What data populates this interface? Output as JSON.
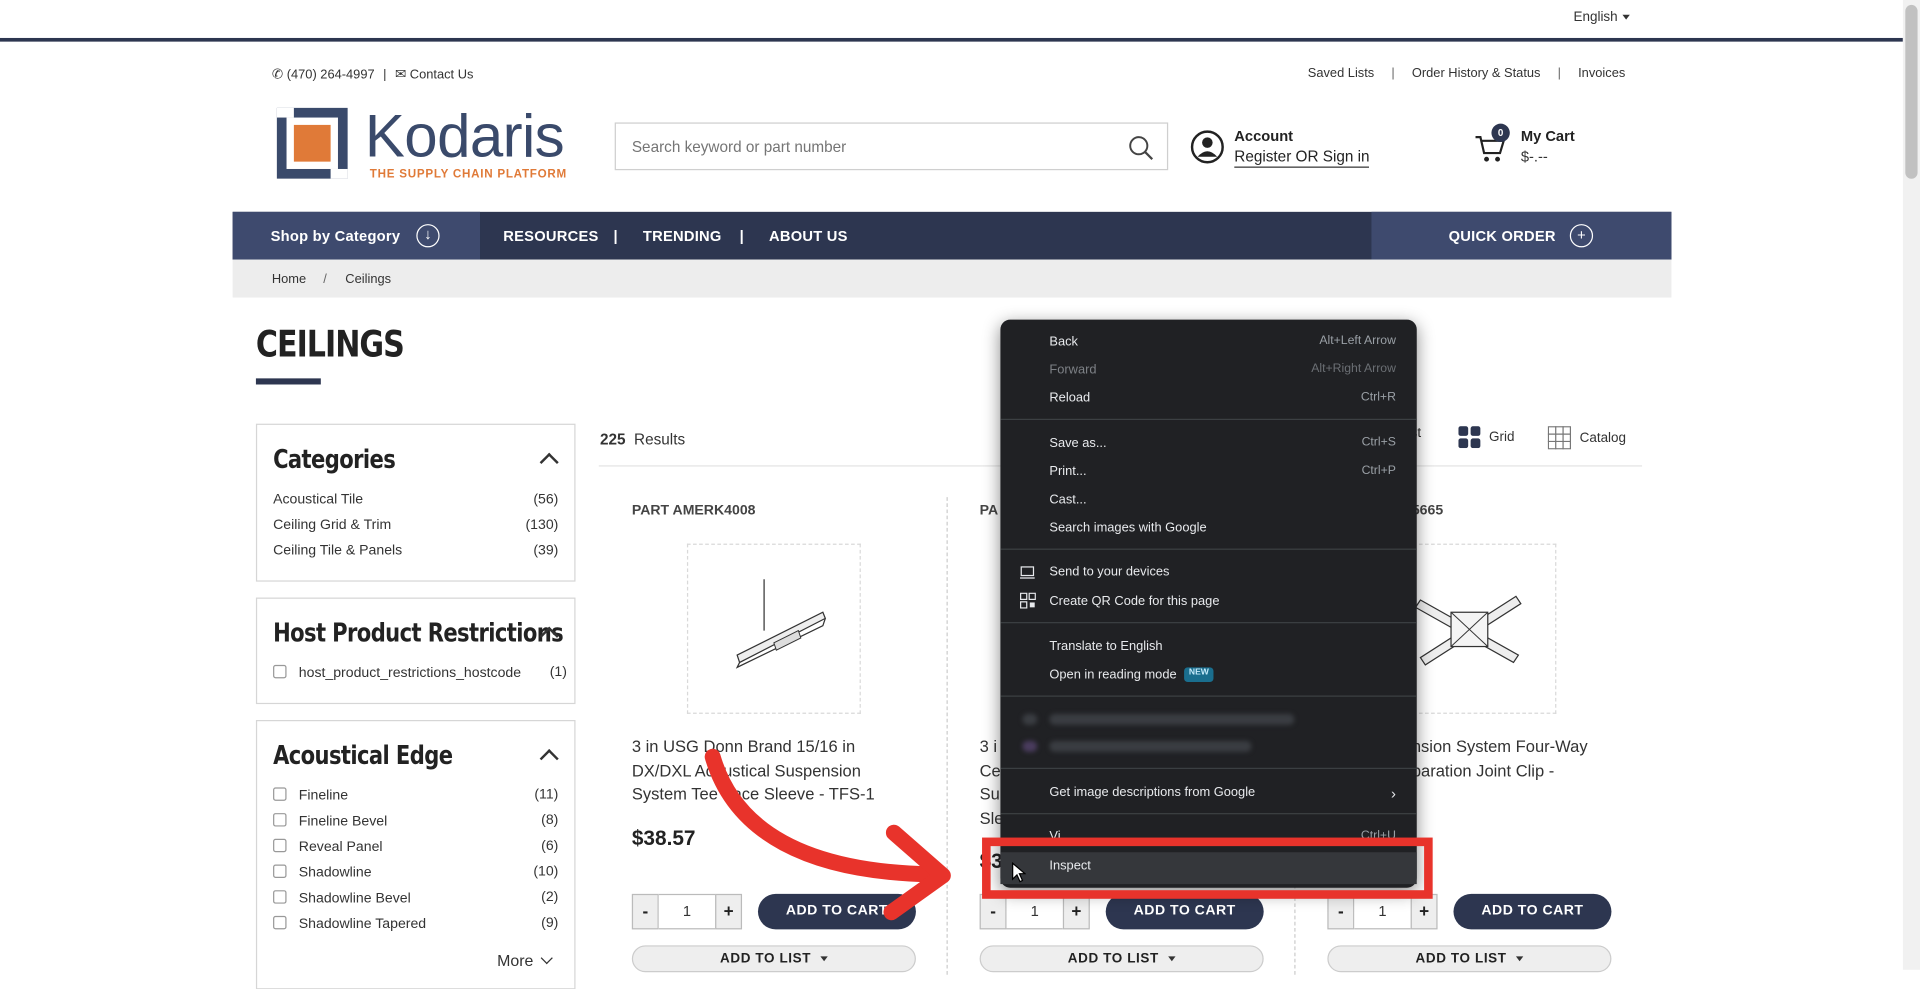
{
  "language": "English",
  "contact": {
    "phone": "(470) 264-4997",
    "separator": "|",
    "contact_label": "Contact Us"
  },
  "util_links": [
    "Saved Lists",
    "Order History & Status",
    "Invoices"
  ],
  "logo": {
    "name": "Kodaris",
    "tagline": "THE SUPPLY CHAIN PLATFORM",
    "brand_color": "#3a4a6b",
    "accent_color": "#e07a38"
  },
  "search": {
    "placeholder": "Search keyword or part number"
  },
  "account": {
    "title": "Account",
    "link": "Register OR Sign in"
  },
  "cart": {
    "title": "My Cart",
    "total": "$-.--",
    "count": "0"
  },
  "nav": {
    "shop_by_category": "Shop by Category",
    "items": [
      "RESOURCES",
      "TRENDING",
      "ABOUT US"
    ],
    "sep": "|",
    "quick_order": "QUICK ORDER"
  },
  "breadcrumb": {
    "home": "Home",
    "sep": "/",
    "current": "Ceilings"
  },
  "page_title": "CEILINGS",
  "facets": {
    "categories": {
      "title": "Categories",
      "items": [
        {
          "label": "Acoustical Tile",
          "count": "(56)"
        },
        {
          "label": "Ceiling Grid & Trim",
          "count": "(130)"
        },
        {
          "label": "Ceiling Tile & Panels",
          "count": "(39)"
        }
      ]
    },
    "host": {
      "title": "Host Product Restrictions",
      "items": [
        {
          "label": "host_product_restrictions_hostcode",
          "count": "(1)"
        }
      ]
    },
    "edge": {
      "title": "Acoustical Edge",
      "items": [
        {
          "label": "Fineline",
          "count": "(11)"
        },
        {
          "label": "Fineline Bevel",
          "count": "(8)"
        },
        {
          "label": "Reveal Panel",
          "count": "(6)"
        },
        {
          "label": "Shadowline",
          "count": "(10)"
        },
        {
          "label": "Shadowline Bevel",
          "count": "(2)"
        },
        {
          "label": "Shadowline Tapered",
          "count": "(9)"
        }
      ],
      "more": "More"
    }
  },
  "results": {
    "count": "225",
    "label": "Results"
  },
  "views": {
    "list_partial": "st",
    "grid": "Grid",
    "catalog": "Catalog"
  },
  "products": [
    {
      "part": "PART AMERK4008",
      "name": "3 in USG Donn Brand 15/16 in DX/DXL Acoustical Suspension System Tee Face Sleeve - TFS-1",
      "price": "$38.57",
      "qty": "1"
    },
    {
      "part": "PA",
      "name_lines": [
        "3 i",
        "Ce",
        "Su",
        "Sle"
      ],
      "price": "$3",
      "qty": "1"
    },
    {
      "part": "5665",
      "name": "nsion System Four-Way paration Joint Clip -",
      "qty": "1"
    }
  ],
  "buttons": {
    "add_to_cart": "ADD TO CART",
    "add_to_list": "ADD TO LIST",
    "minus": "-",
    "plus": "+"
  },
  "context_menu": {
    "items": [
      {
        "label": "Back",
        "shortcut": "Alt+Left Arrow"
      },
      {
        "label": "Forward",
        "shortcut": "Alt+Right Arrow"
      },
      {
        "label": "Reload",
        "shortcut": "Ctrl+R"
      },
      {
        "label": "Save as...",
        "shortcut": "Ctrl+S"
      },
      {
        "label": "Print...",
        "shortcut": "Ctrl+P"
      },
      {
        "label": "Cast..."
      },
      {
        "label": "Search images with Google"
      },
      {
        "label": "Send to your devices"
      },
      {
        "label": "Create QR Code for this page"
      },
      {
        "label": "Translate to English"
      },
      {
        "label": "Open in reading mode",
        "badge": "NEW"
      },
      {
        "label": "Get image descriptions from Google"
      },
      {
        "label": "Vi",
        "shortcut": "Ctrl+U"
      },
      {
        "label": "Inspect"
      }
    ]
  },
  "annotation": {
    "highlight_color": "#e8332b"
  }
}
